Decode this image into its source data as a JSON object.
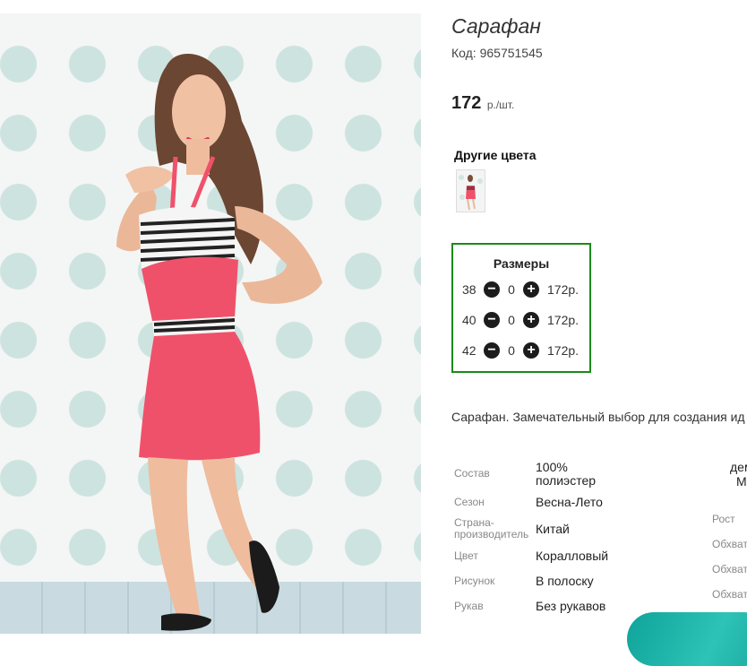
{
  "product": {
    "title": "Сарафан",
    "code": "Код: 965751545",
    "price_amount": "172",
    "price_unit": "р./шт.",
    "image_alt": "Сарафан"
  },
  "other_colors": {
    "title": "Другие цвета"
  },
  "sizes": {
    "title": "Размеры",
    "rows": [
      {
        "size": "38",
        "qty": "0",
        "price": "172р."
      },
      {
        "size": "40",
        "qty": "0",
        "price": "172р."
      },
      {
        "size": "42",
        "qty": "0",
        "price": "172р."
      }
    ],
    "minus_symbol": "−",
    "plus_symbol": "+"
  },
  "description": "Сарафан. Замечательный выбор для создания ид",
  "specs": [
    {
      "label": "Состав",
      "value": "100% полиэстер"
    },
    {
      "label": "Сезон",
      "value": "Весна-Лето"
    },
    {
      "label": "Страна-производитель",
      "value": "Китай"
    },
    {
      "label": "Цвет",
      "value": "Коралловый"
    },
    {
      "label": "Рисунок",
      "value": "В полоску"
    },
    {
      "label": "Рукав",
      "value": "Без рукавов"
    }
  ],
  "specs_side": {
    "top_value_1": "дем",
    "top_value_2": "М",
    "labels": [
      "Рост",
      "Обхват",
      "Обхват",
      "Обхват"
    ]
  },
  "colors": {
    "accent": "#1a8a1a",
    "chat": "#1aa89f",
    "dress": "#f0516a"
  }
}
